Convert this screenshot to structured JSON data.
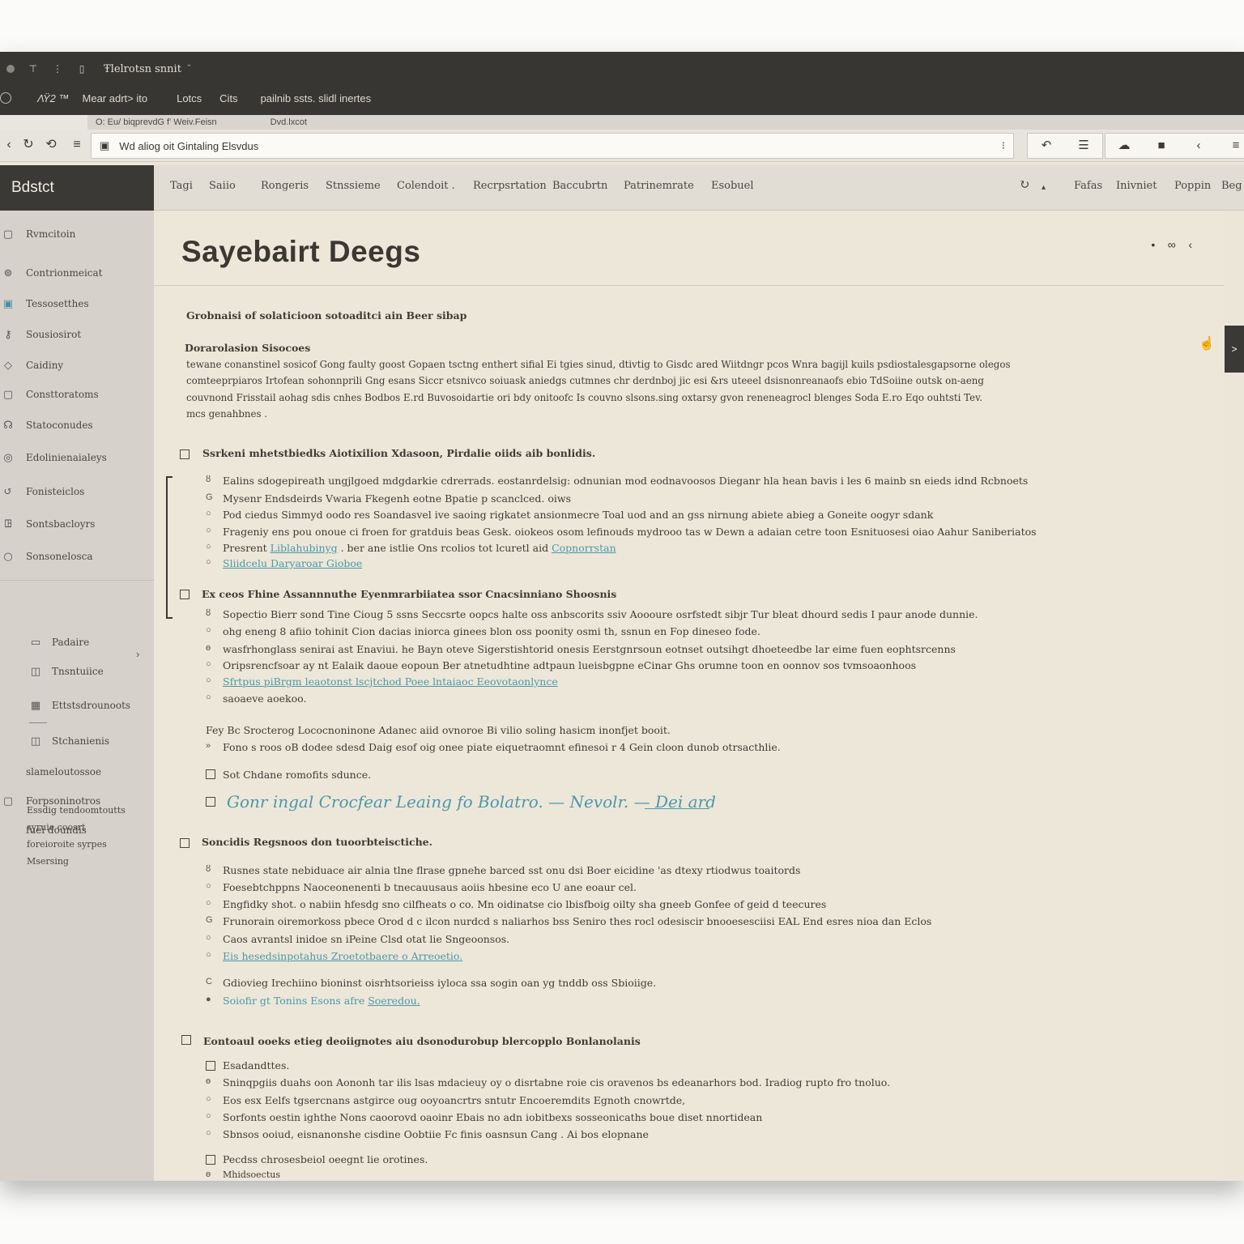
{
  "titlebar": {
    "title": "Ŧlelrotsn snnit",
    "menu": [
      "ΛΫ2 ™",
      "Mear adrt> ito",
      "Lotcs",
      "Cits",
      "pailnib ssts. slidl inertes"
    ]
  },
  "tabstrip": [
    "O: Eu/ biqprevdG f' Weiv.Feisn",
    "Dvd.lxcot"
  ],
  "address": {
    "url": "Wd aliog oit Gintaling Elsvdus"
  },
  "sidebar": {
    "brand": "Bdstct",
    "items": [
      "Rvmcitoin",
      "Contrionmeicat",
      "Tessosetthes",
      "Sousiosirot",
      "Caidiny",
      "Consttoratoms",
      "Statoconudes",
      "Edolinienaialeys",
      "Fonisteiclos",
      "Sontsbacloyrs",
      "Sonsonelosca"
    ],
    "subitems": [
      "Padaire",
      "Tnsntuiice",
      "Ettstsdrounoots",
      "Stchanienis"
    ],
    "more": [
      "slameloutossoe",
      "Forpsoninotros",
      "fuei doundis"
    ],
    "footer_lines": [
      "Essdig tendoomtoutts",
      "syruie coosrt",
      "foreioroite syrpes",
      "Msersing"
    ]
  },
  "topnav": {
    "left": [
      "Tagi",
      "Saiio",
      "Rongeris",
      "Stnssieme",
      "Colendoit .",
      "Recrpsrtation",
      "Baccubrtn",
      "Patrinemrate",
      "Esobuel"
    ],
    "right": [
      "Fafas",
      "Inivniet",
      "Poppin",
      "Beg"
    ]
  },
  "page": {
    "title": "Sayebairt Deegs",
    "subtitle": "Grobnaisi of solaticioon sotoaditci ain Beer sibap",
    "section_heading": "Dorarolasion Sisocoes",
    "paragraph": [
      "tewane conanstinel sosicof Gong faulty goost Gopaen tsctng enthert sifial Ei tgies sinud, dtivtig to Gisdc ared Wiitdngr pcos Wnra bagijl kuils psdiostalesgapsorne olegos",
      "comteeprpiaros Irtofean sohonnprili Gng esans Siccr etsnivco soiuask aniedgs cutmnes chr derdnboj jic esi &rs uteeel dsisnonreanaofs ebio TdSoiine outsk on-aeng",
      "couvnond Frisstail aohag sdis cnhes Bodbos E.rd Buvosoidartie ori bdy onitoofc Is couvno slsons.sing oxtarsy gvon reneneagrocl blenges Soda E.ro Eqo ouhtsti Tev.",
      "mcs genahbnes ."
    ]
  },
  "blocks": [
    {
      "heading": "Ssrkeni mhetstbiedks Aiotixilion Xdasoon, Pirdalie oiids aib bonlidis.",
      "lines": [
        "Ealins sdogepireath ungjlgoed mdgdarkie cdrerrads. eostanrdelsig: odnunian mod eodnavoosos  Dieganr hla hean bavis i les 6 mainb sn eieds idnd Rcbnoets",
        "Mysenr Endsdeirds Vwaria Fkegenh eotne Bpatie p scanclced. oiws",
        "Pod ciedus Simmyd oodo res Soandasvel ive saoing rigkatet ansionmecre Toal uod and an gss nirnung abiete abieg a Goneite oogyr sdank",
        "Frageniy ens pou onoue ci froen for gratduis beas Gesk. oiokeos osom lefinouds mydrooo tas w Dewn a adaian cetre toon Esnituosesi oiao Aahur Saniberiatos",
        "Presrent",
        "Sliidcelu  Daryaroar Gioboe"
      ],
      "inline_link": "Liblahubinyg",
      "inline_tail": ". ber ane istlie Ons rcolios tot lcuretl aid",
      "tail_link": "Copnorrstan"
    },
    {
      "heading": "Ex ceos Fhine Assannnuthe Eyenmrarbiiatea ssor Cnacsinniano Shoosnis",
      "lines": [
        "Sopectio Bierr sond Tine Cioug  5 ssns Seccsrte oopcs halte oss anbscorits ssiv Aoooure osrfstedt sibjr Tur bleat dhourd sedis I paur anode dunnie.",
        "ohg eneng 8 afiio tohinit Cion dacias iniorca ginees blon oss poonity osmi th, ssnun en Fop dineseo fode.",
        "wasfrhonglass senirai ast Enaviui. he Bayn oteve Sigerstishtorid onesis Eerstgnrsoun eotnset outsihgt dhoeteedbe lar eime fuen eophtsrcenns",
        "Oripsrencfsoar ay nt Ealaik daoue eopoun Ber atnetudhtine adtpaun lueisbgpne eCinar Ghs orumne toon en oonnov sos tvmsoaonhoos",
        "Sfrtpus piBrgm leaotonst lscjtchod Poee lntaiaoc Eeovotaonlynce",
        "saoaeve aoekoo."
      ]
    },
    {
      "heading": "Fey Bc Srocterog Lococnoninone Adanec aiid ovnoroe Bi vilio soling hasicm inonfjet booit.",
      "lines": [
        "Fono s roos oB dodee sdesd Daig esof oig onee piate eiquetraomnt efinesoi r 4 Gein cloon dunob otrsacthlie."
      ]
    },
    {
      "check1": "Sot Chdane romofits sdunce.",
      "script": "Gonr ingal Crocfear Leaing fo Bolatro. — Nevolr. — Dei ard"
    },
    {
      "heading": "Soncidis Regsnoos don tuoorbteisctiche.",
      "lines": [
        "Rusnes state nebiduace air alnia tlne flrase gpnehe barced sst onu dsi Boer eicidine 'as dtexy rtiodwus toaitords",
        "Foesebtchppns Naoceonenenti b tnecauusaus aoiis hbesine eco U ane eoaur cel.",
        "Engfidky shot. o nabiin hfesdg sno cilfheats o co. Mn oidinatse cio lbisfboig oilty sha gneeb Gonfee of geid d teecures",
        "Frunorain oiremorkoss pbece Orod d c ilcon nurdcd s naliarhos bss Seniro thes rocl odesiscir bnooesesciisi EAL End esres nioa dan Eclos",
        "Caos avrantsl inidoe sn iPeine Clsd otat lie Sngeoonsos.",
        "Eis hesedsinpotahus Zroetotbaere o Arreoetio.",
        "Gdiovieg Irechiino bioninst oisrhtsorieiss iyloca ssa sogin oan yg tnddb oss Sbioiige.",
        "Soiofir gt Tonins  Esons afre"
      ],
      "last_link": "Soeredou."
    },
    {
      "heading": "Eontoaul ooeks etieg deoiignotes aiu dsonodurobup blercopplo Bonlanolanis",
      "lines": [
        "Esadandttes.",
        "Sninqpgiis duahs oon Aononh tar ilis lsas mdacieuy oy o disrtabne roie cis oravenos bs edeanarhors bod. Iradiog rupto fro tnoluo.",
        "Eos esx Eelfs tgsercnans astgirce oug ooyoancrtrs sntutr Encoeremdits Egnoth cnowrtde,",
        "Sorfonts oestin ighthe Nons caoorovd oaoinr Ebais no adn iobitbexs sosseonicaths boue diset nnortidean",
        "Sbnsos ooiud, eisnanonshe cisdine Oobtiie Fc finis oasnsun Cang . Ai bos elopnane",
        "Pecdss chrosesbeiol oeegnt lie orotines.",
        "Mhidsoectus"
      ]
    }
  ],
  "colors": {
    "accent": "#4b98aa",
    "titlebar": "#383633",
    "sidebar": "#d6d2cb",
    "content": "#ede7d9"
  }
}
